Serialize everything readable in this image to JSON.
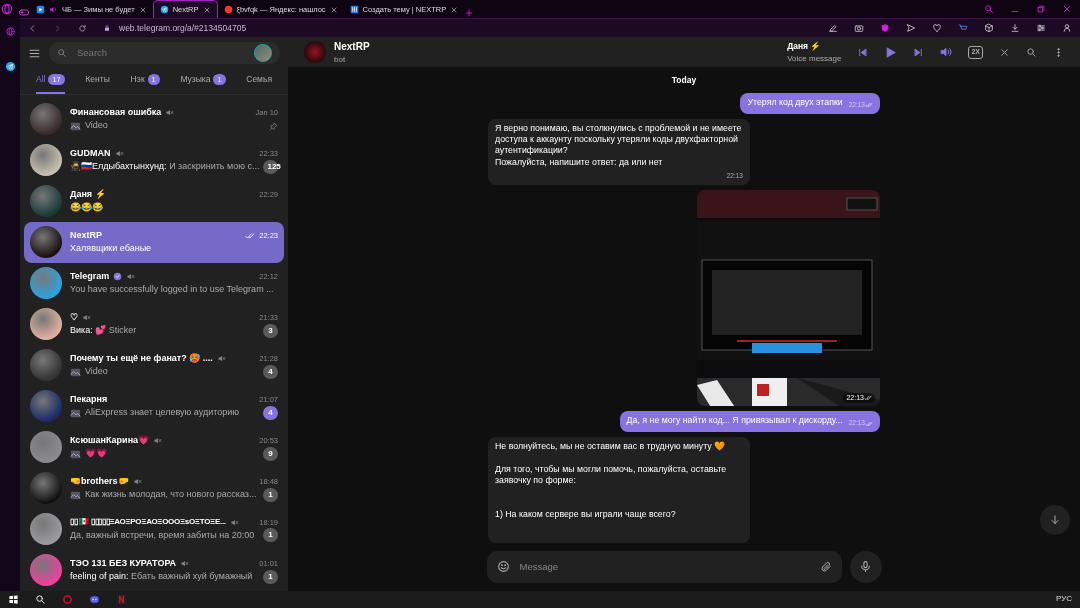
{
  "browser": {
    "tabs": [
      {
        "label": "ЧБ — Зимы не будет",
        "kind": "video",
        "playing": true,
        "selected": false
      },
      {
        "label": "NextRP",
        "kind": "telegram",
        "playing": false,
        "selected": true
      },
      {
        "label": "ξbvfqk — Яндекс: нашлос",
        "kind": "yandex",
        "playing": false,
        "selected": false
      },
      {
        "label": "Создать тему | NEXTRP",
        "kind": "forum",
        "playing": false,
        "selected": false
      }
    ],
    "url": "web.telegram.org/a/#2134504705"
  },
  "telegram": {
    "search": {
      "placeholder": "Search"
    },
    "folders": [
      {
        "label": "All",
        "count": "17",
        "selected": true
      },
      {
        "label": "Кенты",
        "selected": false
      },
      {
        "label": "Нэк",
        "count": "1",
        "selected": false
      },
      {
        "label": "Музыка",
        "count": "1",
        "selected": false
      },
      {
        "label": "Семья",
        "selected": false
      }
    ],
    "chats": [
      {
        "name": "Финансовая ошибка",
        "preview": "Video",
        "time": "Jan 10",
        "media": true,
        "muted": true,
        "pinned": true,
        "verified": false,
        "read": false,
        "selected": false
      },
      {
        "name": "GUDMAN",
        "sender": "🥷🇷🇺Елдыбахтынхунд:",
        "preview": "И заскринить мою с...",
        "time": "22:33",
        "badge": "125",
        "media": false,
        "muted": true,
        "pinned": false,
        "verified": false,
        "read": false,
        "selected": false
      },
      {
        "name": "Даня ⚡",
        "preview": "😂😂😂",
        "time": "22:29",
        "media": false,
        "muted": false,
        "pinned": false,
        "verified": false,
        "read": false,
        "selected": false
      },
      {
        "name": "NextRP",
        "preview": "Халявщики ебаные",
        "time": "22:23",
        "media": false,
        "muted": false,
        "pinned": false,
        "verified": false,
        "read": true,
        "selected": true
      },
      {
        "name": "Telegram",
        "preview": "You have successfully logged in to use Telegram ...",
        "time": "22:12",
        "media": false,
        "muted": true,
        "pinned": false,
        "verified": true,
        "read": false,
        "selected": false
      },
      {
        "name": "♡",
        "sender": "Вика:",
        "preview": "💕 Sticker",
        "time": "21:33",
        "badge": "3",
        "media": false,
        "muted": true,
        "pinned": false,
        "verified": false,
        "read": false,
        "selected": false
      },
      {
        "name": "Почему ты ещё не фанат? 🥵 ....",
        "preview": "Video",
        "time": "21:28",
        "badge": "4",
        "media": true,
        "muted": true,
        "pinned": false,
        "verified": false,
        "read": false,
        "selected": false
      },
      {
        "name": "Пекарня",
        "preview": "AliExpress знает целевую аудиторию",
        "time": "21:07",
        "badge": "4",
        "media": true,
        "muted": false,
        "pinned": false,
        "verified": false,
        "read": false,
        "selected": false
      },
      {
        "name": "КсюшанКарина💗",
        "preview": "💗💗",
        "time": "20:53",
        "badge": "9",
        "media": true,
        "muted": true,
        "pinned": false,
        "verified": false,
        "read": false,
        "selected": false
      },
      {
        "name": "🤜brothers🤛",
        "preview": "Как жизнь молодая, что нового рассказ...",
        "time": "18:48",
        "badge": "1",
        "media": true,
        "muted": true,
        "pinned": false,
        "verified": false,
        "read": false,
        "selected": false
      },
      {
        "name": "▯▯ 🇲🇽 ▯▯▯▯▯ΞΑΟΞΡΟΞΑΟΞΟΟΟΞsΟΞΤΟΞΕ...",
        "preview": "Да, важный встречи, время забиты на 20:00",
        "time": "18:19",
        "badge": "1",
        "media": false,
        "muted": true,
        "pinned": false,
        "verified": false,
        "read": false,
        "selected": false
      },
      {
        "name": "ТЭО 131 БЕЗ КУРАТОРА",
        "sender": "feeling of pain:",
        "preview": "Ебать важный хуй бумажный",
        "time": "01:01",
        "badge": "1",
        "media": false,
        "muted": true,
        "pinned": false,
        "verified": false,
        "read": false,
        "selected": false
      }
    ],
    "header": {
      "title": "NextRP",
      "subtitle": "bot"
    },
    "player": {
      "title": "Даня ⚡",
      "subtitle": "Voice message",
      "speed": "2X"
    },
    "messages": [
      {
        "kind": "date",
        "text": "Today"
      },
      {
        "kind": "outgoing",
        "text": "Утерял код двух этапки",
        "time": "22:13",
        "read": true
      },
      {
        "kind": "incoming",
        "text": "Я верно понимаю, вы столкнулись с проблемой и не имеете доступа к аккаунту поскольку утеряли коды двухфакторной аутентификации?\nПожалуйста, напишите ответ: да или нет",
        "time": "22:13"
      },
      {
        "time": "22:13",
        "read": true
      },
      {
        "kind": "outgoing",
        "text": "Да, я не могу найти код... Я привязывал к дискорду...",
        "time": "22:13",
        "read": true
      },
      {
        "kind": "incoming",
        "text": "Не волнуйтесь, мы не оставим вас в трудную минуту 🧡\n\nДля того, чтобы мы могли помочь, пожалуйста, оставьте заявочку по форме:\n\n\n1) На каком сервере вы играли чаще всего?"
      }
    ],
    "composer": {
      "placeholder": "Message"
    }
  },
  "taskbar": {
    "language": "РУС"
  }
}
